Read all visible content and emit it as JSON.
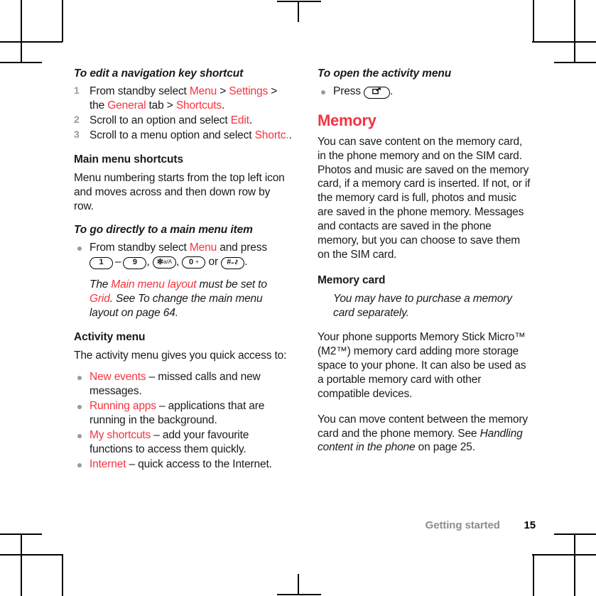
{
  "left_column": {
    "procedure_1": {
      "heading": "To edit a navigation key shortcut",
      "steps": [
        {
          "num": "1",
          "pre": "From standby select ",
          "t1": "Menu",
          "mid1": " > ",
          "t2": "Settings",
          "mid2": " > the ",
          "t3": "General",
          "mid3": " tab > ",
          "t4": "Shortcuts",
          "post": "."
        },
        {
          "num": "2",
          "pre": "Scroll to an option and select ",
          "t1": "Edit",
          "post": "."
        },
        {
          "num": "3",
          "pre": "Scroll to a menu option and select ",
          "t1": "Shortc.",
          "post": "."
        }
      ]
    },
    "main_menu_shortcuts": {
      "heading": "Main menu shortcuts",
      "body": "Menu numbering starts from the top left icon and moves across and then down row by row."
    },
    "procedure_2": {
      "heading": "To go directly to a main menu item",
      "bullet_pre": "From standby select ",
      "bullet_term": "Menu",
      "bullet_post": " and press",
      "keys": {
        "key_1": "1",
        "dash": "–",
        "key_9": "9",
        "key_star_main": "✼",
        "key_star_sub": "a/A",
        "key_0_main": "0",
        "key_0_sub": "+",
        "key_hash_main": "#",
        "or": "or"
      },
      "end_punct": "."
    },
    "note": {
      "pre": "The ",
      "term_1": "Main menu layout",
      "mid": " must be set to ",
      "term_2": "Grid",
      "post": ". See To change the main menu layout on page 64."
    },
    "activity_menu": {
      "heading": "Activity menu",
      "intro": "The activity menu gives you quick access to:",
      "items": [
        {
          "term": "New events",
          "desc": " – missed calls and new messages."
        },
        {
          "term": "Running apps",
          "desc": " – applications that are running in the background."
        },
        {
          "term": "My shortcuts",
          "desc": " – add your favourite functions to access them quickly."
        },
        {
          "term": "Internet",
          "desc": " – quick access to the Internet."
        }
      ]
    }
  },
  "right_column": {
    "procedure_3": {
      "heading": "To open the activity menu",
      "bullet_pre": "Press ",
      "bullet_post": "."
    },
    "memory": {
      "heading": "Memory",
      "body": "You can save content on the memory card, in the phone memory and on the SIM card. Photos and music are saved on the memory card, if a memory card is inserted. If not, or if the memory card is full, photos and music are saved in the phone memory. Messages and contacts are saved in the phone memory, but you can choose to save them on the SIM card."
    },
    "memory_card": {
      "heading": "Memory card",
      "note": "You may have to purchase a memory card separately.",
      "paragraph_1": "Your phone supports Memory Stick Micro™ (M2™) memory card adding more storage space to your phone. It can also be used as a portable memory card with other compatible devices.",
      "paragraph_2_pre": "You can move content between the memory card and the phone memory. See ",
      "paragraph_2_italic": "Handling content in the phone",
      "paragraph_2_post": " on page 25."
    }
  },
  "footer": {
    "section": "Getting started",
    "page_number": "15"
  },
  "colors": {
    "accent_red": "#F5333F",
    "marker_gray": "#9a9a9a",
    "footer_gray": "#8d8d8d",
    "text_black": "#1a1a1a"
  }
}
